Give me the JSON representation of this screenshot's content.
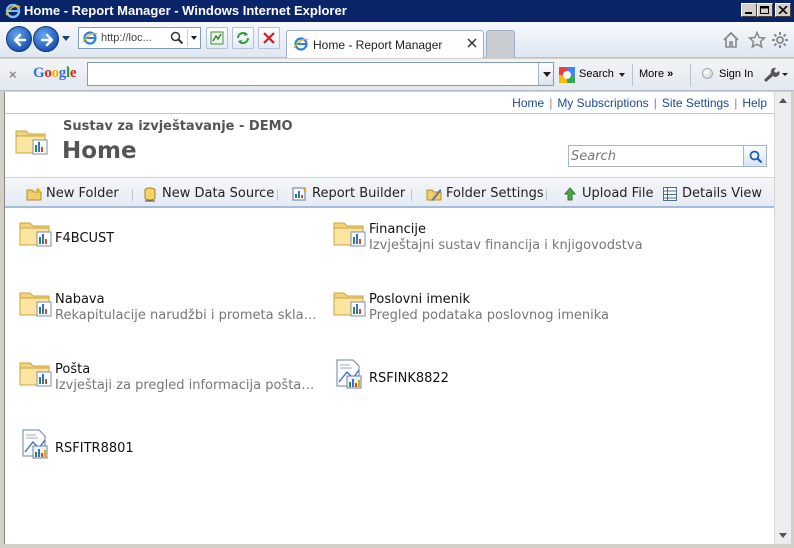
{
  "window": {
    "title": "Home - Report Manager - Windows Internet Explorer"
  },
  "browser": {
    "address": "http://loc...",
    "tab_label": "Home - Report Manager"
  },
  "google_toolbar": {
    "close_glyph": "×",
    "logo_letters": [
      "G",
      "o",
      "o",
      "g",
      "l",
      "e"
    ],
    "logo_colors": [
      "#3b6ee6",
      "#d7281c",
      "#f0b400",
      "#3b6ee6",
      "#2d9e32",
      "#d7281c"
    ],
    "search_label": "Search",
    "more_label": "More",
    "more_glyph": "»",
    "signin_label": "Sign In"
  },
  "report_manager": {
    "top_links": [
      "Home",
      "My Subscriptions",
      "Site Settings",
      "Help"
    ],
    "subtitle": "Sustav za izvještavanje - DEMO",
    "page_title": "Home",
    "search_placeholder": "Search",
    "toolbar": [
      {
        "label": "New Folder",
        "icon": "new-folder-icon"
      },
      {
        "label": "New Data Source",
        "icon": "new-data-source-icon"
      },
      {
        "label": "Report Builder",
        "icon": "report-builder-icon"
      },
      {
        "label": "Folder Settings",
        "icon": "folder-settings-icon"
      },
      {
        "label": "Upload File",
        "icon": "upload-file-icon"
      },
      {
        "label": "Details View",
        "icon": "details-view-icon"
      }
    ],
    "items": [
      {
        "name": "F4BCUST",
        "description": "",
        "type": "folder"
      },
      {
        "name": "Financije",
        "description": "Izvještajni sustav financija i knjigovodstva",
        "type": "folder"
      },
      {
        "name": "Nabava",
        "description": "Rekapitulacije narudžbi i prometa skladišta",
        "type": "folder"
      },
      {
        "name": "Poslovni imenik",
        "description": "Pregled podataka poslovnog imenika",
        "type": "folder"
      },
      {
        "name": "Pošta",
        "description": "Izvještaji za pregled informacija poštansk...",
        "type": "folder"
      },
      {
        "name": "RSFINK8822",
        "description": "",
        "type": "report"
      },
      {
        "name": "RSFITR8801",
        "description": "",
        "type": "report"
      }
    ]
  }
}
